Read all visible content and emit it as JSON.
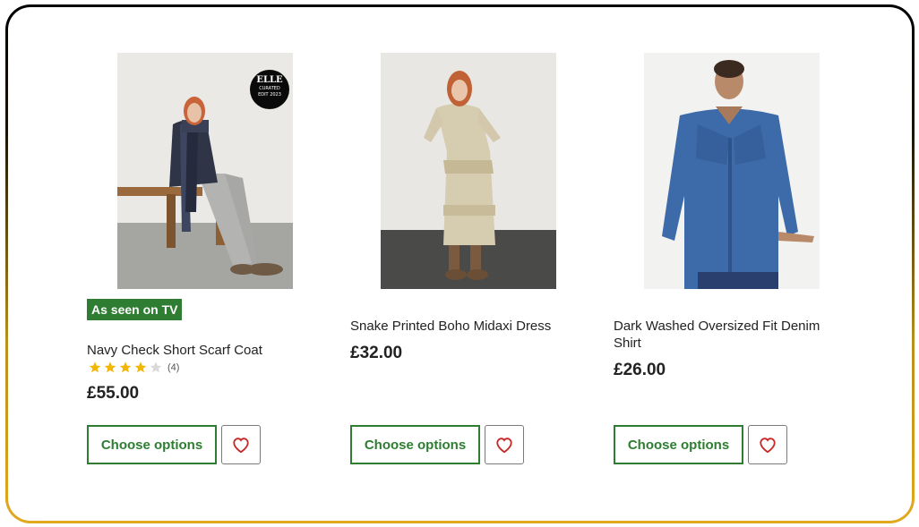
{
  "products": [
    {
      "badge": "As seen on TV",
      "image_alt": "Woman in navy check scarf coat sitting on a wooden bench",
      "elle_logo": "ELLE",
      "elle_line1": "CURATED",
      "elle_line2": "EDIT 2023",
      "name": "Navy Check Short Scarf Coat",
      "rating": 4,
      "rating_max": 5,
      "rating_count": "(4)",
      "price": "£55.00",
      "choose_label": "Choose options",
      "wishlist_icon": "heart-icon"
    },
    {
      "image_alt": "Woman in snake printed boho midaxi dress",
      "name": "Snake Printed Boho Midaxi Dress",
      "price": "£32.00",
      "choose_label": "Choose options",
      "wishlist_icon": "heart-icon"
    },
    {
      "image_alt": "Woman in dark washed oversized denim shirt",
      "name": "Dark Washed Oversized Fit Denim Shirt",
      "price": "£26.00",
      "choose_label": "Choose options",
      "wishlist_icon": "heart-icon"
    }
  ],
  "colors": {
    "accent_green": "#2e7d32",
    "star_gold": "#f2b705",
    "heart_red": "#c62828"
  }
}
